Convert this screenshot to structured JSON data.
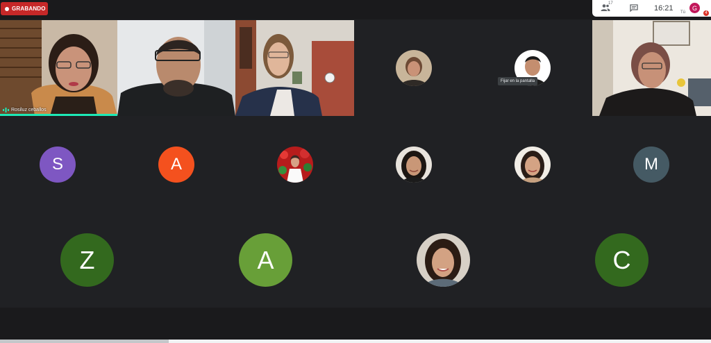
{
  "recording": {
    "label": "GRABANDO"
  },
  "top_panel": {
    "people_count": "17",
    "clock": "16:21",
    "you_initial": "G",
    "you_label": "Tú",
    "notification_count": "4"
  },
  "video_tiles": [
    {
      "name": "Rosiluz ceballos"
    },
    {
      "name": ""
    },
    {
      "name": ""
    },
    {
      "name": ""
    }
  ],
  "hover_tooltip": "Fijar en la pantalla",
  "participants_row2": [
    {
      "initial": "S",
      "color": "#7e57c2"
    },
    {
      "initial": "A",
      "color": "#f4511e"
    },
    {
      "photo": "red-flowers-portrait"
    },
    {
      "photo": "woman-dark-hair"
    },
    {
      "photo": "woman-smiling"
    },
    {
      "initial": "M",
      "color": "#455a64"
    }
  ],
  "participants_row3": [
    {
      "initial": "Z",
      "color": "#33691e"
    },
    {
      "initial": "A",
      "color": "#689f38"
    },
    {
      "photo": "woman-smiling-dark-hair"
    },
    {
      "initial": "C",
      "color": "#33691e"
    }
  ],
  "colors": {
    "accent": "#1de9b6",
    "background": "#202124"
  }
}
